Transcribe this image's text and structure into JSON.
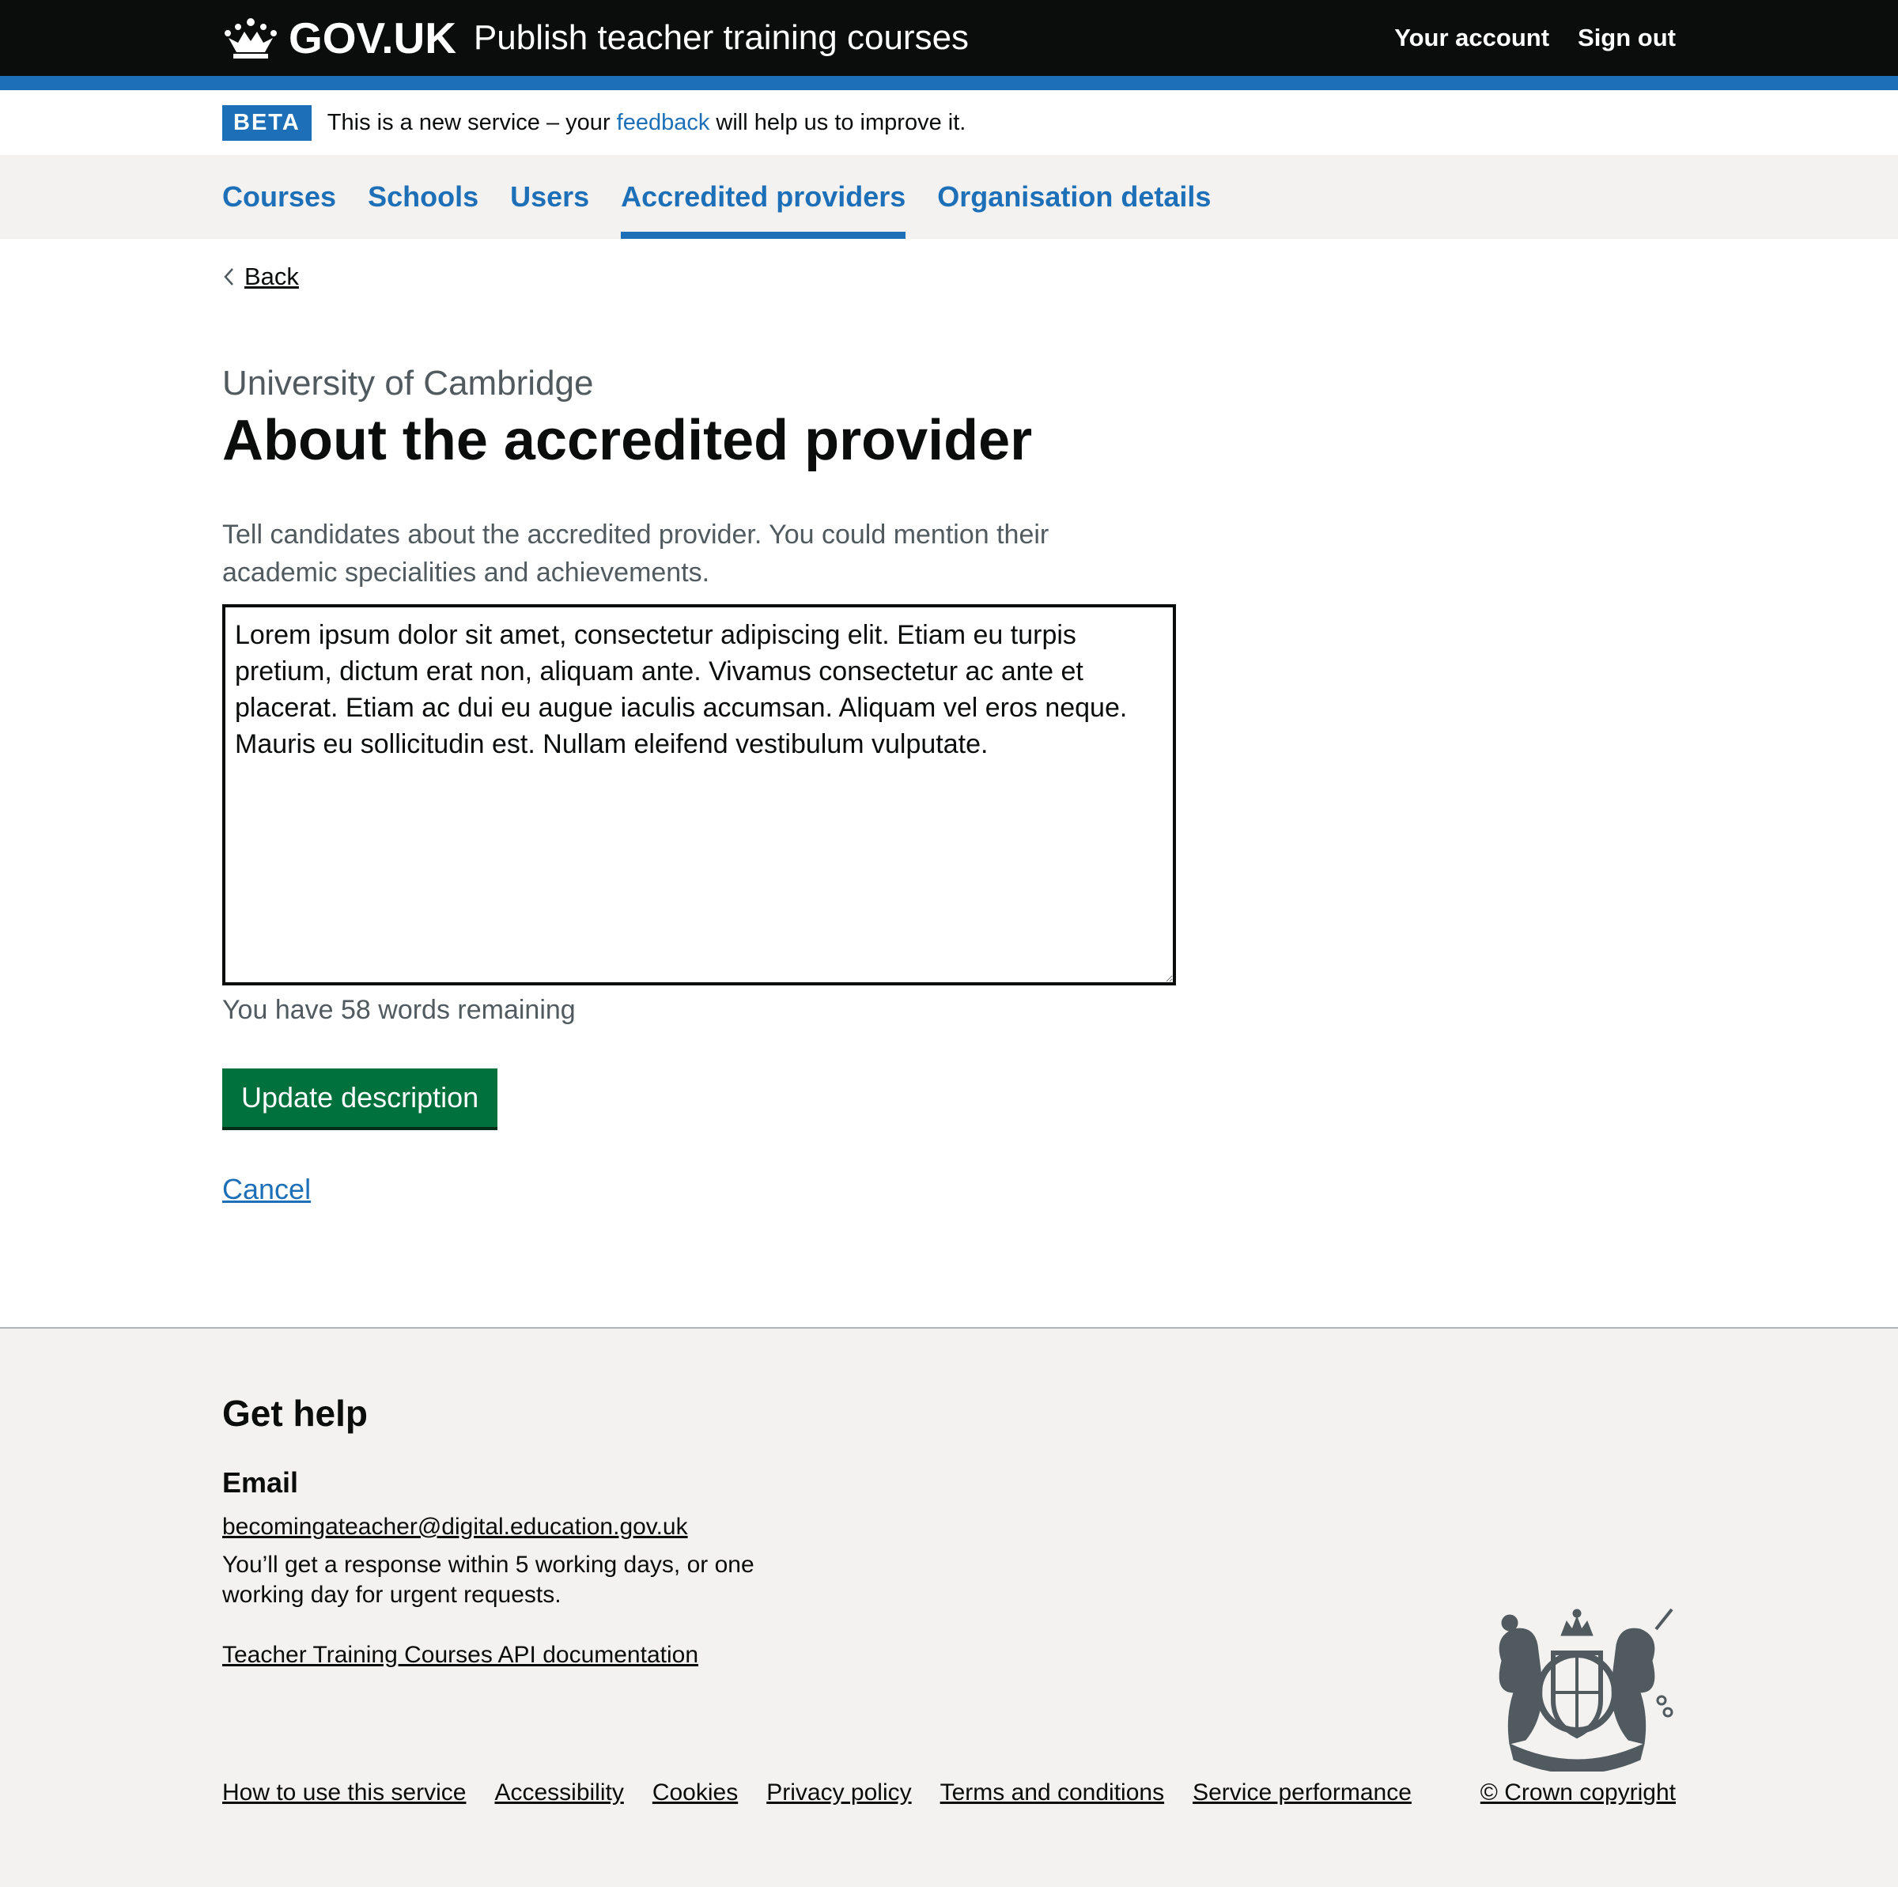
{
  "header": {
    "logo_text": "GOV.UK",
    "service_name": "Publish teacher training courses",
    "nav": [
      {
        "label": "Your account"
      },
      {
        "label": "Sign out"
      }
    ]
  },
  "beta_banner": {
    "tag": "BETA",
    "text_before": "This is a new service – your ",
    "link": "feedback",
    "text_after": " will help us to improve it."
  },
  "primary_nav": {
    "items": [
      {
        "label": "Courses"
      },
      {
        "label": "Schools"
      },
      {
        "label": "Users"
      },
      {
        "label": "Accredited providers",
        "active": true
      },
      {
        "label": "Organisation details"
      }
    ]
  },
  "main": {
    "back_label": "Back",
    "caption": "University of Cambridge",
    "title": "About the accredited provider",
    "hint": "Tell candidates about the accredited provider. You could mention their academic specialities and achievements.",
    "textarea_value": "Lorem ipsum dolor sit amet, consectetur adipiscing elit. Etiam eu turpis pretium, dictum erat non, aliquam ante. Vivamus consectetur ac ante et placerat. Etiam ac dui eu augue iaculis accumsan. Aliquam vel eros neque. Mauris eu sollicitudin est. Nullam eleifend vestibulum vulputate.",
    "word_count": "You have 58 words remaining",
    "submit_label": "Update description",
    "cancel_label": "Cancel"
  },
  "footer": {
    "help_heading": "Get help",
    "email_heading": "Email",
    "email": "becomingateacher@digital.education.gov.uk",
    "response_text": "You’ll get a response within 5 working days, or one working day for urgent requests.",
    "api_link": "Teacher Training Courses API documentation",
    "links": [
      {
        "label": "How to use this service"
      },
      {
        "label": "Accessibility"
      },
      {
        "label": "Cookies"
      },
      {
        "label": "Privacy policy"
      },
      {
        "label": "Terms and conditions"
      },
      {
        "label": "Service performance"
      }
    ],
    "copyright": "© Crown copyright"
  },
  "colors": {
    "header_bg": "#0b0c0c",
    "brand_blue": "#1d70b8",
    "button_green": "#00703c",
    "footer_bg": "#f3f2f1",
    "secondary_text": "#505a5f"
  },
  "icons": {
    "logo": "crown-icon",
    "back": "chevron-left-icon",
    "footer": "royal-crest-icon"
  }
}
